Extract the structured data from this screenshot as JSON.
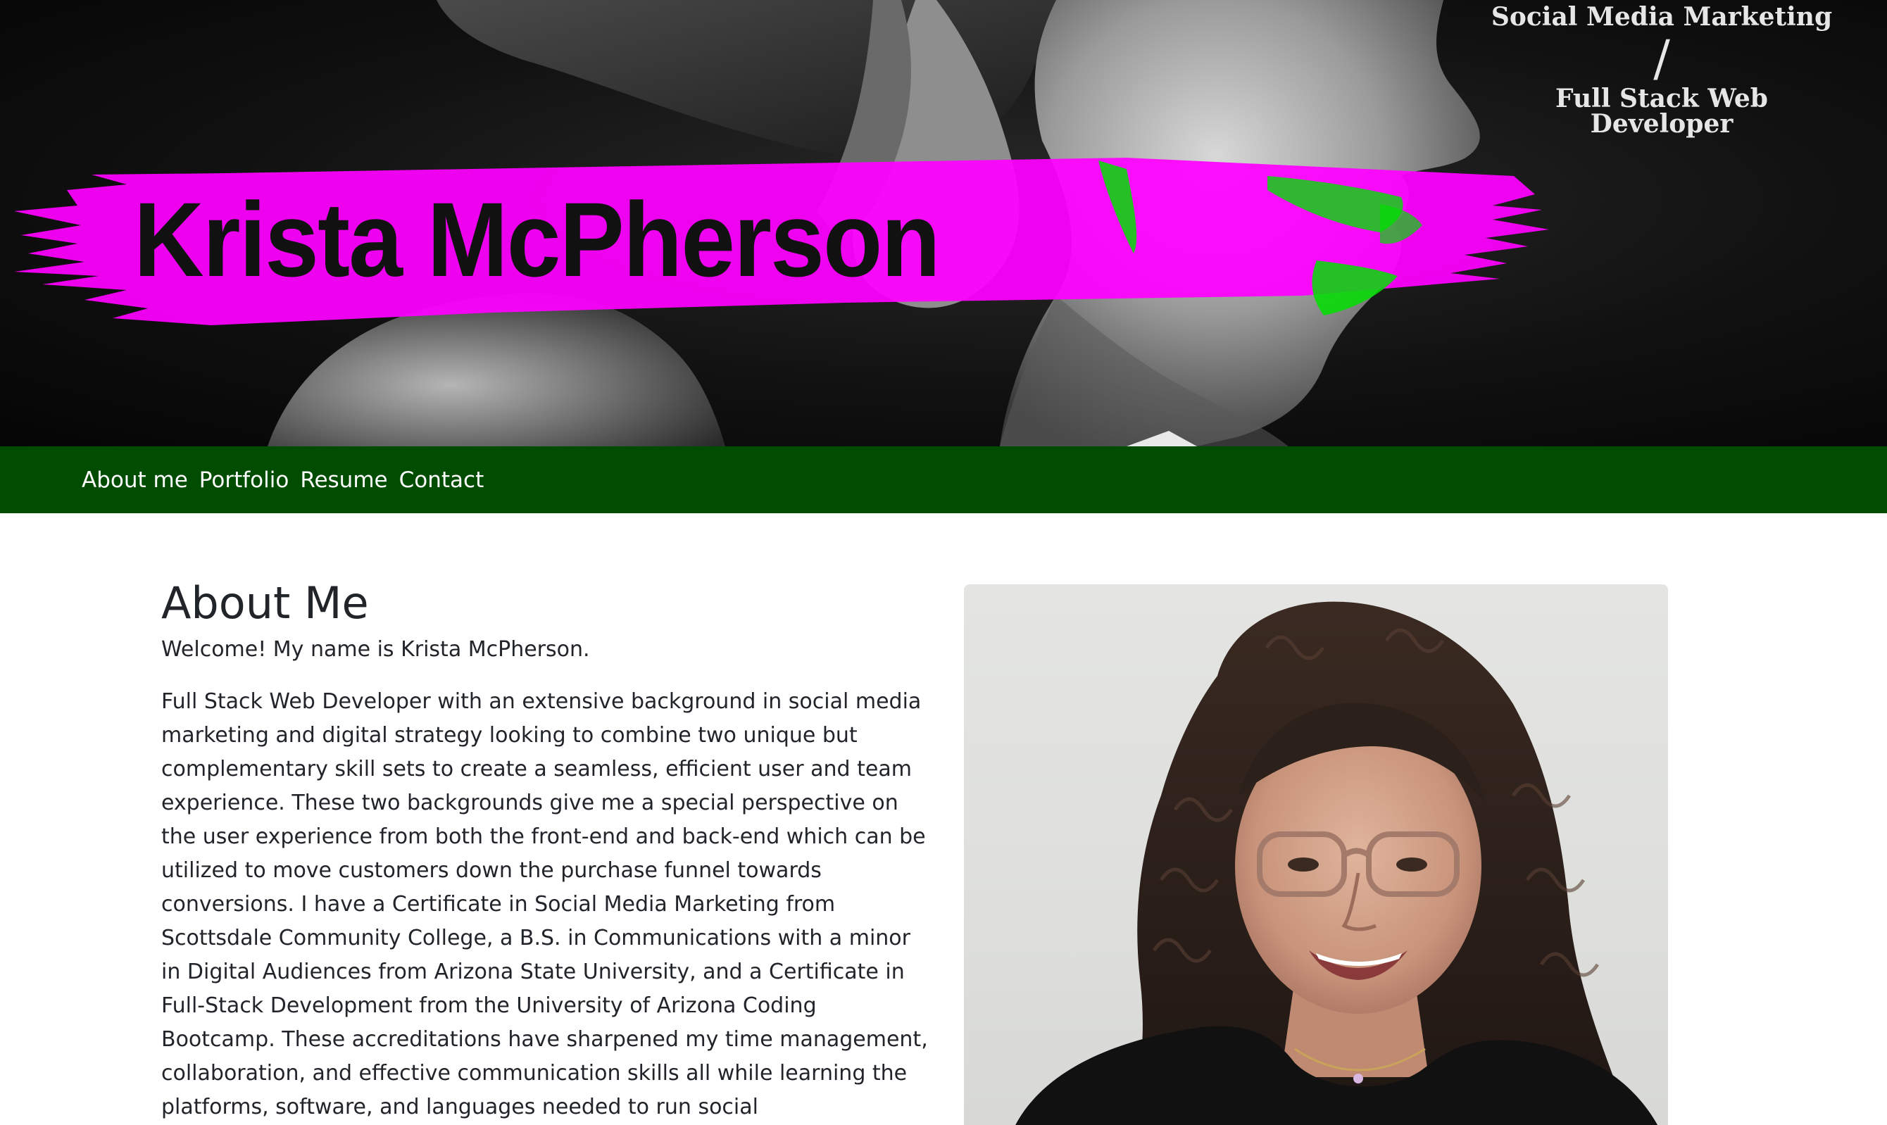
{
  "hero": {
    "name": "Krista McPherson",
    "tagline_top": "Social Media Marketing",
    "tagline_divider": "/",
    "tagline_bottom": "Full Stack Web Developer",
    "accent_color": "#ff00ff",
    "accent_green": "#00e000"
  },
  "nav": {
    "background": "#004c00",
    "links": [
      {
        "label": "About me"
      },
      {
        "label": "Portfolio"
      },
      {
        "label": "Resume"
      },
      {
        "label": "Contact"
      }
    ]
  },
  "about": {
    "title": "About Me",
    "welcome": "Welcome! My name is Krista McPherson.",
    "body": "Full Stack Web Developer with an extensive background in social media marketing and digital strategy looking to combine two unique but complementary skill sets to create a seamless, efficient user and team experience. These two backgrounds give me a special perspective on the user experience from both the front-end and back-end which can be utilized to move customers down the purchase funnel towards conversions. I have a Certificate in Social Media Marketing from Scottsdale Community College, a B.S. in Communications with a minor in Digital Audiences from Arizona State University, and a Certificate in Full-Stack Development from the University of Arizona Coding Bootcamp. These accreditations have sharpened my time management, collaboration, and effective communication skills all while learning the platforms, software, and languages needed to run social"
  }
}
